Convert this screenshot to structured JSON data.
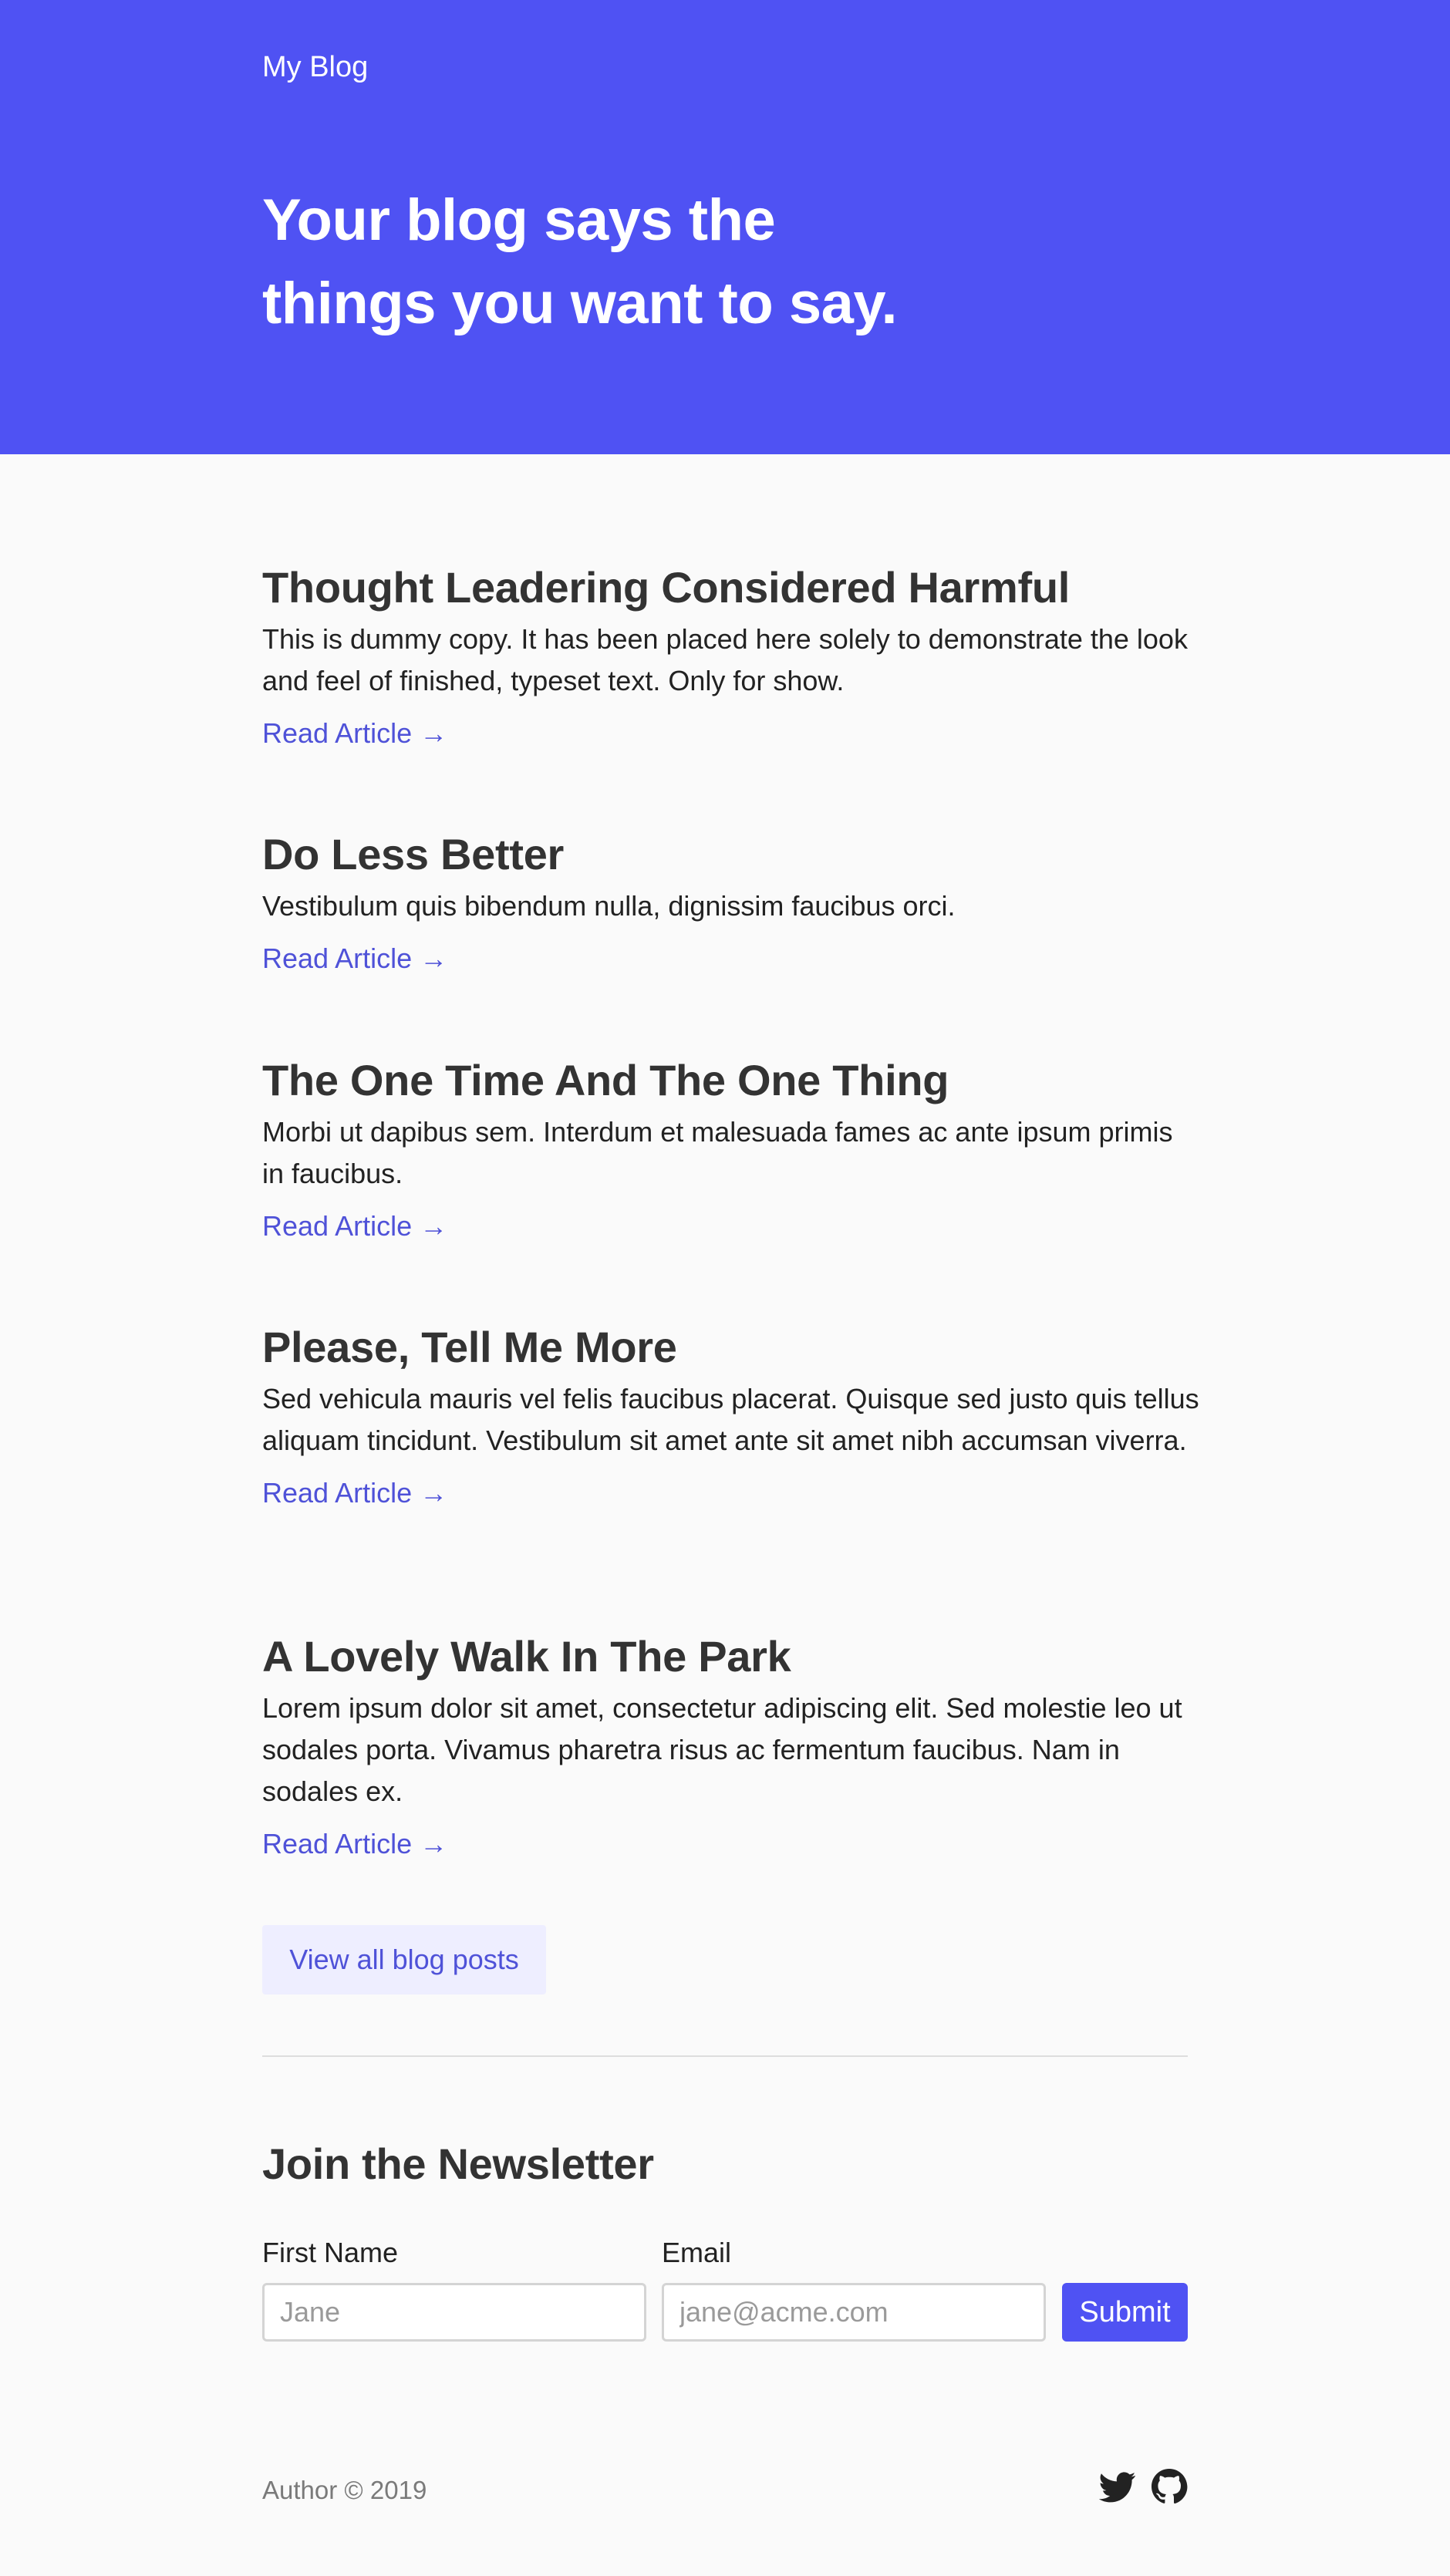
{
  "header": {
    "site_title": "My Blog",
    "headline_line1": "Your blog says the",
    "headline_line2": "things you want to say."
  },
  "posts": [
    {
      "title": "Thought Leadering Considered Harmful",
      "excerpt": "This is dummy copy. It has been placed here solely to demonstrate the look and feel of finished, typeset text. Only for show.",
      "link": "Read Article →"
    },
    {
      "title": "Do Less Better",
      "excerpt": "Vestibulum quis bibendum nulla, dignissim faucibus orci.",
      "link": "Read Article →"
    },
    {
      "title": "The One Time And The One Thing",
      "excerpt": "Morbi ut dapibus sem. Interdum et malesuada fames ac ante ipsum primis in faucibus.",
      "link": "Read Article →"
    },
    {
      "title": "Please, Tell Me More",
      "excerpt": "Sed vehicula mauris vel felis faucibus placerat. Quisque sed justo quis tellus aliquam tincidunt. Vestibulum sit amet ante sit amet nibh accumsan viverra.",
      "link": "Read Article →"
    },
    {
      "title": "A Lovely Walk In The Park",
      "excerpt": "Lorem ipsum dolor sit amet, consectetur adipiscing elit. Sed molestie leo ut sodales porta. Vivamus pharetra risus ac fermentum faucibus. Nam in sodales ex.",
      "link": "Read Article →"
    }
  ],
  "view_all_label": "View all blog posts",
  "newsletter": {
    "title": "Join the Newsletter",
    "first_name_label": "First Name",
    "first_name_placeholder": "Jane",
    "email_label": "Email",
    "email_placeholder": "jane@acme.com",
    "submit_label": "Submit"
  },
  "footer": {
    "copyright": "Author © 2019",
    "icons": [
      "twitter-icon",
      "github-icon"
    ]
  },
  "colors": {
    "brand": "#4f52f3",
    "link": "#4f52d8",
    "background": "#fafafa"
  }
}
